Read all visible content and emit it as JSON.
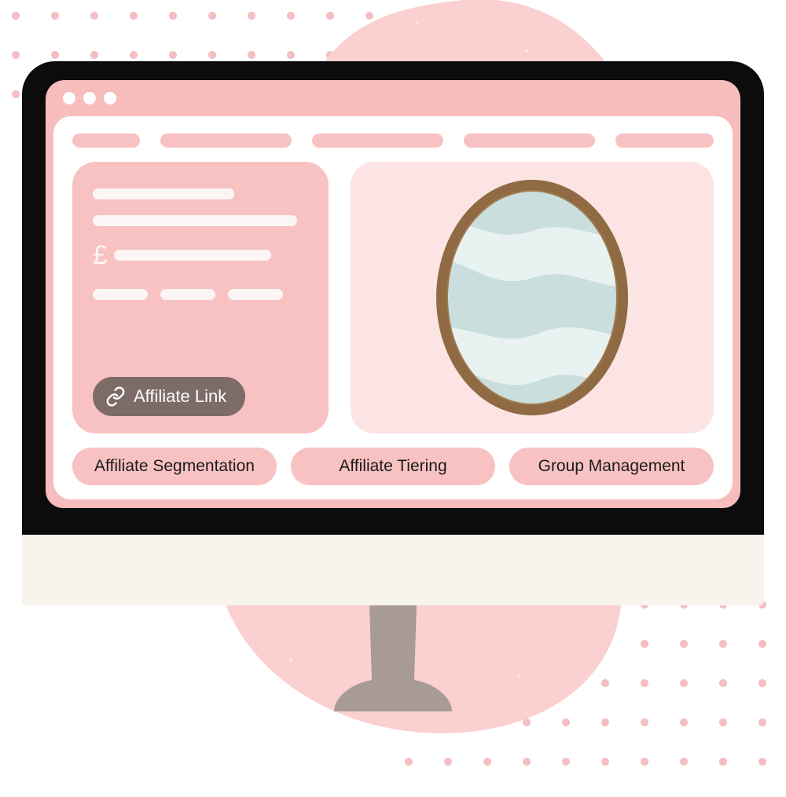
{
  "sidebar": {
    "currency_symbol": "£",
    "affiliate_button_label": "Affiliate Link"
  },
  "bottom_pills": [
    "Affiliate Segmentation",
    "Affiliate Tiering",
    "Group Management"
  ]
}
